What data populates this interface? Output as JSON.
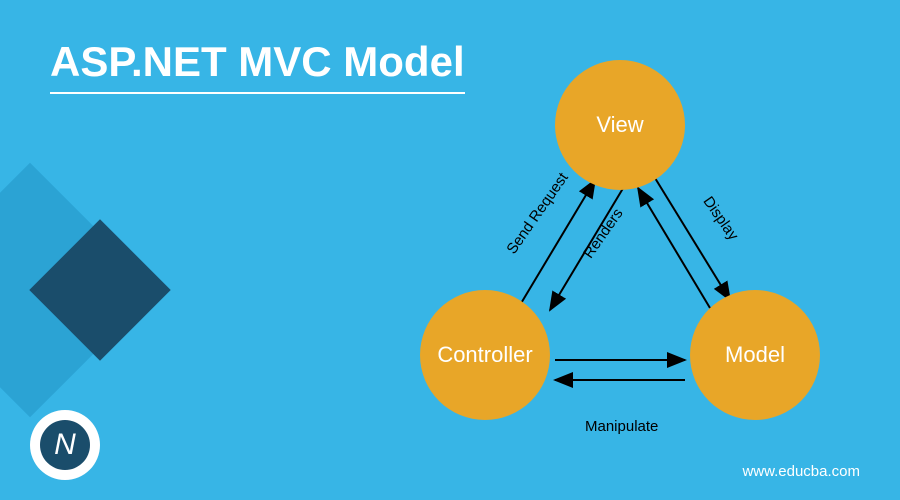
{
  "title": "ASP.NET MVC Model",
  "nodes": {
    "view": "View",
    "controller": "Controller",
    "model": "Model"
  },
  "edges": {
    "send_request": "Send Request",
    "renders": "Renders",
    "display": "Display",
    "manipulate": "Manipulate"
  },
  "logo_glyph": "N",
  "url": "www.educba.com",
  "colors": {
    "background": "#37b5e6",
    "circle": "#e8a628",
    "accent_dark": "#1a4d6b",
    "accent_light": "#2ba3d4",
    "text_white": "#ffffff",
    "text_black": "#000000"
  }
}
